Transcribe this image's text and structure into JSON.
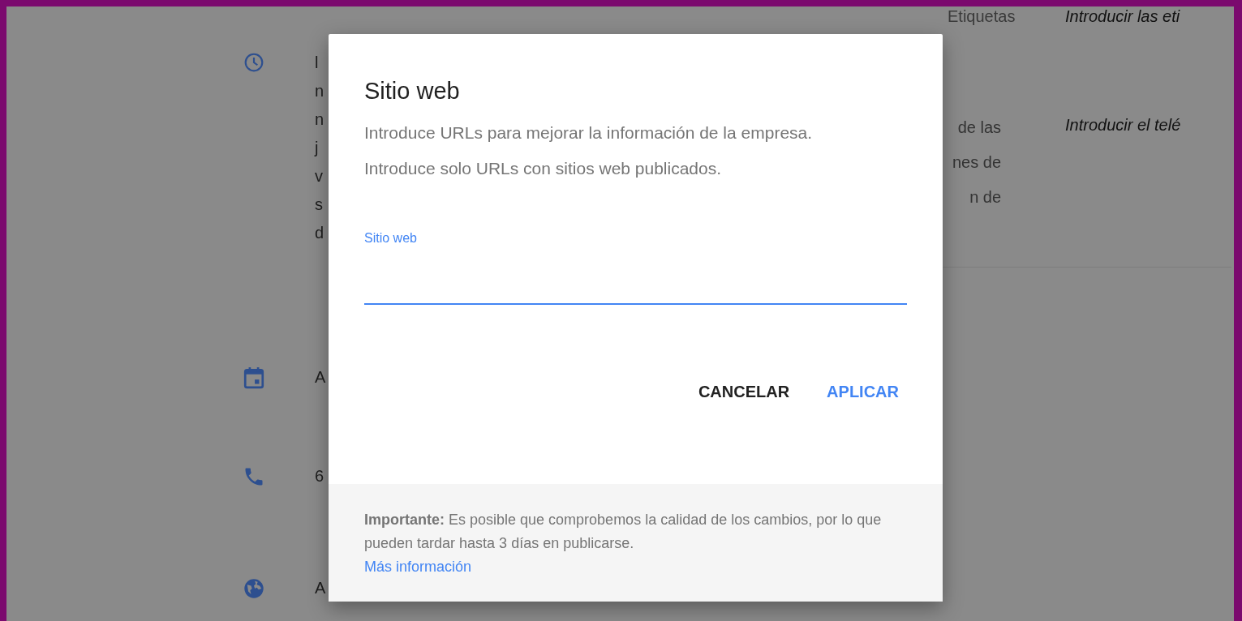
{
  "background": {
    "left_items": [
      {
        "kind": "clock",
        "lines": [
          "l",
          "n",
          "n",
          "j",
          "v",
          "s",
          "d"
        ]
      },
      {
        "kind": "calendar",
        "lines": [
          "A"
        ]
      },
      {
        "kind": "phone",
        "lines": [
          "6"
        ]
      },
      {
        "kind": "globe",
        "lines": [
          "A"
        ]
      }
    ],
    "right_panel": {
      "label_1": "Etiquetas",
      "value_1": "Introducir las eti",
      "label_2_lines": [
        "de las",
        "nes de",
        "n de"
      ],
      "value_2": "Introducir el telé"
    }
  },
  "dialog": {
    "title": "Sitio web",
    "description": "Introduce URLs para mejorar la información de la empresa. Introduce solo URLs con sitios web publicados.",
    "field": {
      "label": "Sitio web",
      "focused": true
    },
    "buttons": [
      {
        "label": "CANCELAR",
        "kind": "secondary"
      },
      {
        "label": "APLICAR",
        "kind": "primary"
      }
    ],
    "notice": "**Importante:** Es posible que comprobemos la calidad de los cambios, por lo que pueden tardar hasta 3 días en publicarse.",
    "link": "Más información"
  }
}
